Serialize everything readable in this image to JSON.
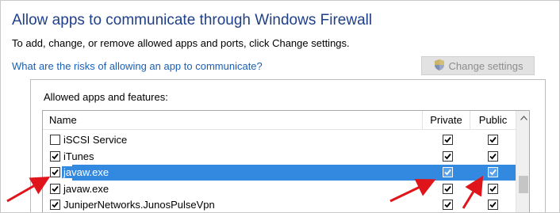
{
  "window": {
    "title": "Allow apps to communicate through Windows Firewall",
    "subtitle": "To add, change, or remove allowed apps and ports, click Change settings.",
    "risk_link": "What are the risks of allowing an app to communicate?",
    "change_settings_label": "Change settings",
    "change_settings_icon": "shield-icon"
  },
  "group": {
    "label": "Allowed apps and features:"
  },
  "table": {
    "columns": [
      "Name",
      "Private",
      "Public"
    ],
    "rows": [
      {
        "name": "iSCSI Service",
        "checked": false,
        "private": true,
        "public": true,
        "selected": false
      },
      {
        "name": "iTunes",
        "checked": true,
        "private": true,
        "public": true,
        "selected": false
      },
      {
        "name": "javaw.exe",
        "checked": true,
        "private": true,
        "public": true,
        "selected": true
      },
      {
        "name": "javaw.exe",
        "checked": true,
        "private": true,
        "public": true,
        "selected": false
      },
      {
        "name": "JuniperNetworks.JunosPulseVpn",
        "checked": true,
        "private": true,
        "public": true,
        "selected": false
      }
    ]
  },
  "colors": {
    "title": "#1e3f8a",
    "link": "#1a5fb4",
    "selection": "#3389e0",
    "annotation_arrow": "#e0151b"
  }
}
